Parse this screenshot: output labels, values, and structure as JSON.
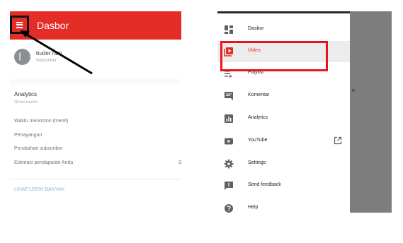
{
  "left_panel": {
    "app_title": "Dasbor",
    "channel": {
      "name": "buder ram",
      "subtitle": "Subscriber"
    },
    "analytics": {
      "title": "Analytics",
      "subtitle": "28 hari terakhir",
      "metrics": [
        "Waktu menonton (menit)",
        "Penayangan",
        "Perubahan subscriber",
        "Estimasi pendapatan Anda"
      ],
      "metric_value_peek": "S",
      "link": "LIHAT LEBIH BANYAK"
    }
  },
  "right_panel": {
    "scrim_peek": "n",
    "nav_items": [
      {
        "label": "Dasbor",
        "icon": "dashboard-icon",
        "active": false
      },
      {
        "label": "Video",
        "icon": "video-icon",
        "active": true
      },
      {
        "label": "Playlist",
        "icon": "playlist-icon",
        "active": false
      },
      {
        "label": "Komentar",
        "icon": "comment-icon",
        "active": false
      },
      {
        "label": "Analytics",
        "icon": "analytics-icon",
        "active": false
      },
      {
        "label": "YouTube",
        "icon": "youtube-icon",
        "active": false,
        "trailing_icon": "open-external-icon"
      },
      {
        "label": "Settings",
        "icon": "settings-icon",
        "active": false
      },
      {
        "label": "Send feedback",
        "icon": "feedback-icon",
        "active": false
      },
      {
        "label": "Help",
        "icon": "help-icon",
        "active": false
      }
    ]
  },
  "colors": {
    "brand_red": "#e52d27",
    "highlight_red": "#e8141b",
    "icon_gray": "#616161",
    "link_blue": "#8fb6e0"
  }
}
